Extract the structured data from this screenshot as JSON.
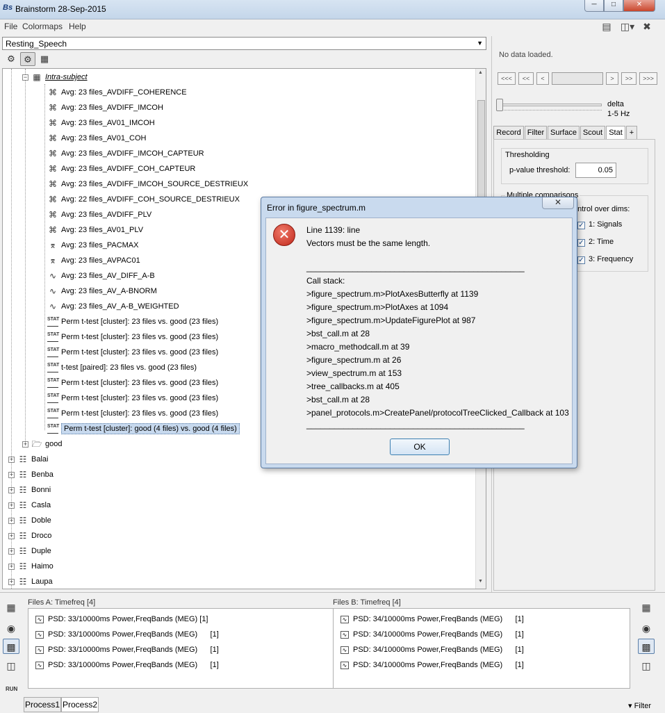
{
  "window": {
    "title": "Brainstorm 28-Sep-2015",
    "logo": "Bs"
  },
  "menu": {
    "file": "File",
    "colormaps": "Colormaps",
    "help": "Help"
  },
  "protocol": {
    "selected": "Resting_Speech"
  },
  "tree": {
    "intra_subject": "Intra-subject",
    "items": [
      {
        "icon": "connectivity-icon",
        "label": "Avg: 23 files_AVDIFF_COHERENCE"
      },
      {
        "icon": "connectivity-icon",
        "label": "Avg: 23 files_AVDIFF_IMCOH"
      },
      {
        "icon": "connectivity-icon",
        "label": "Avg: 23 files_AV01_IMCOH"
      },
      {
        "icon": "connectivity-icon",
        "label": "Avg: 23 files_AV01_COH"
      },
      {
        "icon": "connectivity-icon",
        "label": "Avg: 23 files_AVDIFF_IMCOH_CAPTEUR"
      },
      {
        "icon": "connectivity-icon",
        "label": "Avg: 23 files_AVDIFF_COH_CAPTEUR"
      },
      {
        "icon": "connectivity-icon",
        "label": "Avg: 23 files_AVDIFF_IMCOH_SOURCE_DESTRIEUX"
      },
      {
        "icon": "connectivity-icon",
        "label": "Avg: 22 files_AVDIFF_COH_SOURCE_DESTRIEUX"
      },
      {
        "icon": "connectivity-icon",
        "label": "Avg: 23 files_AVDIFF_PLV"
      },
      {
        "icon": "connectivity-icon",
        "label": "Avg: 23 files_AV01_PLV"
      },
      {
        "icon": "pac-icon",
        "label": "Avg: 23 files_PACMAX"
      },
      {
        "icon": "pac-icon",
        "label": "Avg: 23 files_AVPAC01"
      },
      {
        "icon": "spectrum-icon",
        "label": "Avg: 23 files_AV_DIFF_A-B"
      },
      {
        "icon": "spectrum-icon",
        "label": "Avg: 23 files_AV_A-BNORM"
      },
      {
        "icon": "spectrum-icon",
        "label": "Avg: 23 files_AV_A-B_WEIGHTED"
      },
      {
        "icon": "stat-icon",
        "label": "Perm t-test [cluster]: 23 files vs. good (23 files)"
      },
      {
        "icon": "stat-icon",
        "label": "Perm t-test [cluster]: 23 files vs. good (23 files)"
      },
      {
        "icon": "stat-icon",
        "label": "Perm t-test [cluster]: 23 files vs. good (23 files)"
      },
      {
        "icon": "stat-icon",
        "label": "t-test [paired]: 23 files vs. good (23 files)"
      },
      {
        "icon": "stat-icon",
        "label": "Perm t-test [cluster]: 23 files vs. good (23 files)"
      },
      {
        "icon": "stat-icon",
        "label": "Perm t-test [cluster]: 23 files vs. good (23 files)"
      },
      {
        "icon": "stat-icon",
        "label": "Perm t-test [cluster]: 23 files vs. good (23 files)"
      },
      {
        "icon": "stat-icon",
        "label": "Perm t-test [cluster]: good (4 files) vs. good (4 files)",
        "selected": true
      }
    ],
    "good_folder": "good",
    "subjects": [
      "Balai",
      "Benba",
      "Bonni",
      "Casla",
      "Doble",
      "Droco",
      "Duple",
      "Haimo",
      "Laupa"
    ]
  },
  "right_panel": {
    "no_data": "No data loaded.",
    "nav_buttons": [
      "<<<",
      "<<",
      "<",
      ">",
      ">>",
      ">>>"
    ],
    "freq_band": "delta",
    "freq_range": "1-5 Hz",
    "tabs": [
      "Record",
      "Filter",
      "Surface",
      "Scout",
      "Stat",
      "+"
    ],
    "active_tab": "Stat",
    "thresholding_title": "Thresholding",
    "pvalue_label": "p-value threshold:",
    "pvalue": "0.05",
    "mc_title": "Multiple comparisons",
    "control_label": "ontrol over dims:",
    "dims": [
      "1: Signals",
      "2: Time",
      "3: Frequency"
    ]
  },
  "bottom": {
    "files_a_title": "Files A: Timefreq [4]",
    "files_b_title": "Files B: Timefreq [4]",
    "files_a": [
      "PSD: 33/10000ms Power,FreqBands (MEG) [1]",
      "PSD: 33/10000ms Power,FreqBands (MEG)      [1]",
      "PSD: 33/10000ms Power,FreqBands (MEG)      [1]",
      "PSD: 33/10000ms Power,FreqBands (MEG)      [1]"
    ],
    "files_b": [
      "PSD: 34/10000ms Power,FreqBands (MEG)      [1]",
      "PSD: 34/10000ms Power,FreqBands (MEG)      [1]",
      "PSD: 34/10000ms Power,FreqBands (MEG)      [1]",
      "PSD: 34/10000ms Power,FreqBands (MEG)      [1]"
    ],
    "run_label": "RUN",
    "tab_process1": "Process1",
    "tab_process2": "Process2",
    "filter_label": "Filter"
  },
  "dialog": {
    "title": "Error in figure_spectrum.m",
    "close": "✕",
    "lines": [
      "Line 1139:  line",
      "Vectors must be the same length.",
      "_______________________________________________",
      "Call stack:",
      ">figure_spectrum.m>PlotAxesButterfly at 1139",
      ">figure_spectrum.m>PlotAxes at 1094",
      ">figure_spectrum.m>UpdateFigurePlot at 987",
      ">bst_call.m at 28",
      ">macro_methodcall.m at 39",
      ">figure_spectrum.m at 26",
      ">view_spectrum.m at 153",
      ">tree_callbacks.m at 405",
      ">bst_call.m at 28",
      ">panel_protocols.m>CreatePanel/protocolTreeClicked_Callback at 103",
      "_______________________________________________"
    ],
    "ok": "OK"
  }
}
